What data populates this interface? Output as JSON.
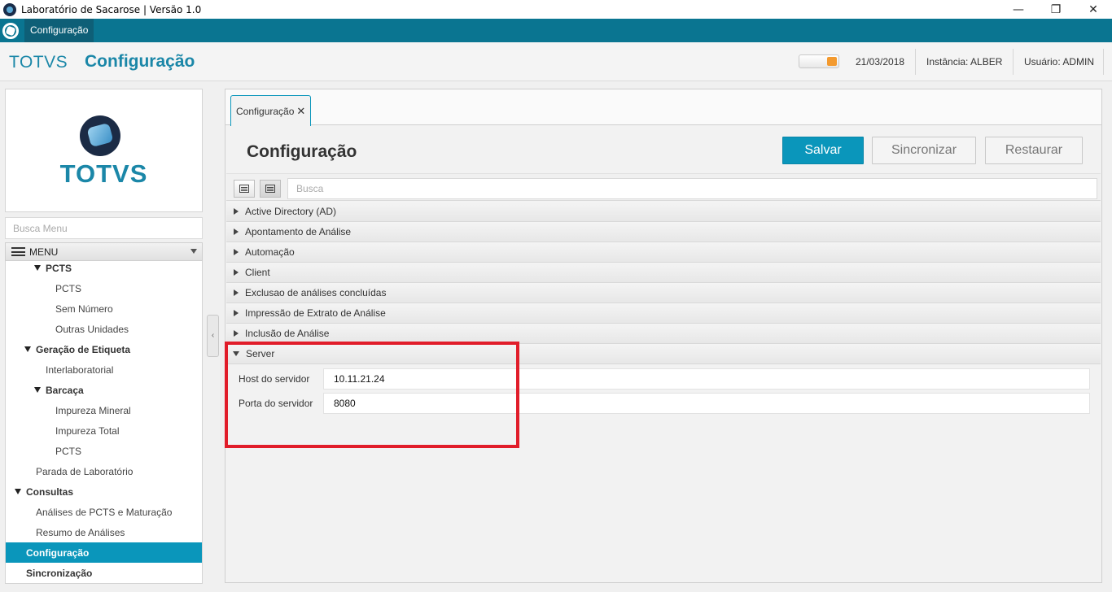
{
  "window": {
    "title": "Laboratório de Sacarose | Versão 1.0",
    "controls": {
      "minimize": "—",
      "maximize": "❐",
      "close": "✕"
    }
  },
  "menubar": {
    "item": "Configuração"
  },
  "header": {
    "brand": "TOTVS",
    "title": "Configuração",
    "date": "21/03/2018",
    "instance": "Instância: ALBER",
    "user": "Usuário: ADMIN",
    "toggle_color": "#f39a2f"
  },
  "sidebar": {
    "logo_text": "TOTVS",
    "search_placeholder": "Busca Menu",
    "menu_label": "MENU",
    "items": [
      {
        "label": "PCTS",
        "bold": true,
        "expanded": true
      },
      {
        "label": "PCTS",
        "bold": false
      },
      {
        "label": "Sem Número",
        "bold": false
      },
      {
        "label": "Outras Unidades",
        "bold": false
      },
      {
        "label": "Geração de Etiqueta",
        "bold": true,
        "expanded": true
      },
      {
        "label": "Interlaboratorial",
        "bold": false
      },
      {
        "label": "Barcaça",
        "bold": true,
        "expanded": true
      },
      {
        "label": "Impureza Mineral",
        "bold": false
      },
      {
        "label": "Impureza Total",
        "bold": false
      },
      {
        "label": "PCTS",
        "bold": false
      },
      {
        "label": "Parada de Laboratório",
        "bold": false
      },
      {
        "label": "Consultas",
        "bold": true,
        "expanded": true
      },
      {
        "label": "Análises de PCTS e Maturação",
        "bold": false
      },
      {
        "label": "Resumo de Análises",
        "bold": false
      },
      {
        "label": "Configuração",
        "bold": true,
        "selected": true
      },
      {
        "label": "Sincronização",
        "bold": true
      }
    ]
  },
  "main": {
    "tab_label": "Configuração",
    "tab_close": "✕",
    "title": "Configuração",
    "buttons": {
      "save": "Salvar",
      "sync": "Sincronizar",
      "restore": "Restaurar"
    },
    "search_placeholder": "Busca",
    "sections": [
      {
        "label": "Active Directory (AD)",
        "expanded": false
      },
      {
        "label": "Apontamento de Análise",
        "expanded": false
      },
      {
        "label": "Automação",
        "expanded": false
      },
      {
        "label": "Client",
        "expanded": false
      },
      {
        "label": "Exclusao de análises concluídas",
        "expanded": false
      },
      {
        "label": "Impressão de Extrato de Análise",
        "expanded": false
      },
      {
        "label": "Inclusão de Análise",
        "expanded": false
      },
      {
        "label": "Server",
        "expanded": true
      }
    ],
    "server_fields": {
      "host_label": "Host do servidor",
      "host_value": "10.11.21.24",
      "port_label": "Porta do servidor",
      "port_value": "8080"
    }
  },
  "colors": {
    "accent": "#0a96bb",
    "menubar": "#0a7591",
    "highlight": "#e11d2a"
  }
}
